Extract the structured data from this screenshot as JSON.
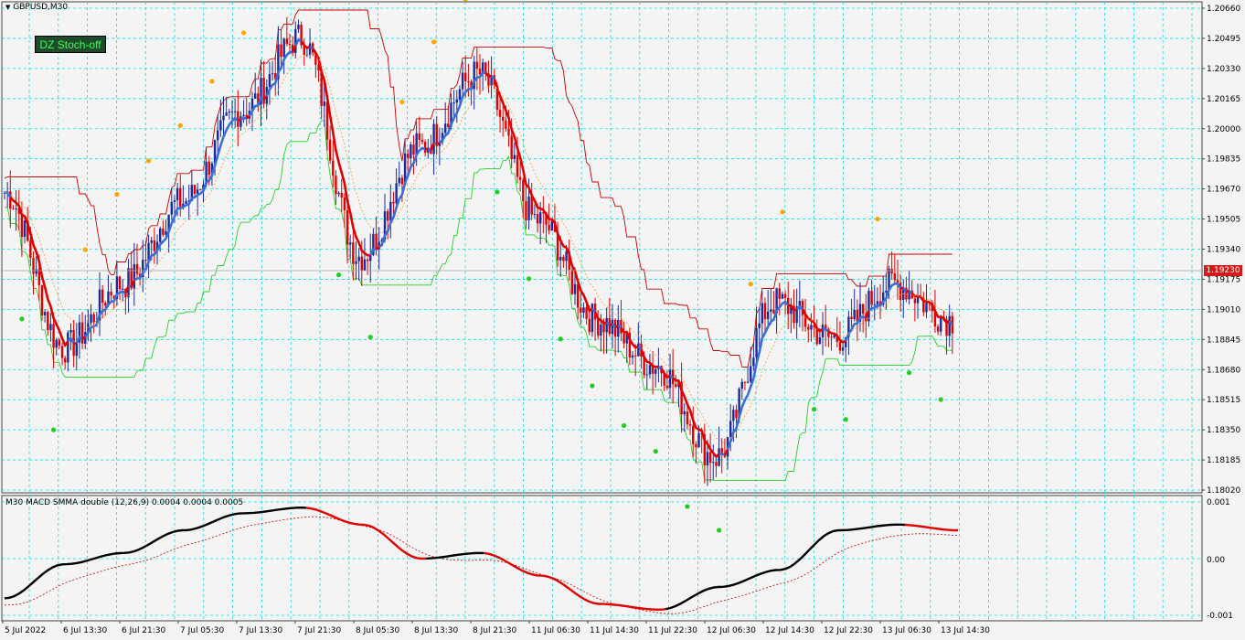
{
  "window": {
    "symbol_label": "GBPUSD,M30",
    "dropdown_icon": "triangle-down-icon"
  },
  "stoch_button": {
    "label": "DZ Stoch-off"
  },
  "price_axis": {
    "labels": [
      "1.20660",
      "1.20495",
      "1.20330",
      "1.20165",
      "1.20000",
      "1.19835",
      "1.19670",
      "1.19505",
      "1.19340",
      "1.19175",
      "1.19010",
      "1.18845",
      "1.18680",
      "1.18515",
      "1.18350",
      "1.18185",
      "1.18020"
    ],
    "current_price": "1.19230"
  },
  "macd": {
    "label": "M30 MACD SMMA double (12,26,9) 0.0004 0.0004 0.0005",
    "axis_labels": [
      "0.001",
      "0.00",
      "-0.001"
    ]
  },
  "time_axis": {
    "labels": [
      "5 Jul 2022",
      "6 Jul 13:30",
      "6 Jul 21:30",
      "7 Jul 05:30",
      "7 Jul 13:30",
      "7 Jul 21:30",
      "8 Jul 05:30",
      "8 Jul 13:30",
      "8 Jul 21:30",
      "11 Jul 06:30",
      "11 Jul 14:30",
      "11 Jul 22:30",
      "12 Jul 06:30",
      "12 Jul 14:30",
      "12 Jul 22:30",
      "13 Jul 06:30",
      "13 Jul 14:30"
    ]
  },
  "colors": {
    "grid": "#19d9d9",
    "bull_candle": "#1a2a9c",
    "bear_candle": "#e00000",
    "ma_red": "#e00000",
    "ma_blue": "#3b6fd8",
    "band_green": "#28d028",
    "band_red": "#c80000",
    "dot_orange": "#ffa500",
    "dot_green": "#22cc22",
    "macd_black": "#000000",
    "macd_red": "#e00000"
  },
  "chart_data": {
    "type": "line",
    "x": [
      "5 Jul 2022",
      "6 Jul 13:30",
      "6 Jul 21:30",
      "7 Jul 05:30",
      "7 Jul 13:30",
      "7 Jul 21:30",
      "8 Jul 05:30",
      "8 Jul 13:30",
      "8 Jul 21:30",
      "11 Jul 06:30",
      "11 Jul 14:30",
      "11 Jul 22:30",
      "12 Jul 06:30",
      "12 Jul 14:30",
      "12 Jul 22:30",
      "13 Jul 06:30",
      "13 Jul 14:30"
    ],
    "series": [
      {
        "values": [
          1.1965,
          1.188,
          1.1915,
          1.196,
          1.201,
          1.205,
          1.193,
          1.199,
          1.203,
          1.195,
          1.1895,
          1.187,
          1.182,
          1.1905,
          1.1885,
          1.1915,
          1.1895
        ]
      }
    ],
    "macd": [
      -0.0007,
      -0.0001,
      0.0001,
      0.0005,
      0.0008,
      0.0009,
      0.0006,
      0.0,
      0.0001,
      -0.0003,
      -0.0008,
      -0.0009,
      -0.0005,
      -0.0002,
      0.0005,
      0.0006,
      0.0005
    ],
    "ylim": [
      1.1802,
      1.2066
    ],
    "macd_ylim": [
      -0.001,
      0.001
    ],
    "grid": true
  }
}
